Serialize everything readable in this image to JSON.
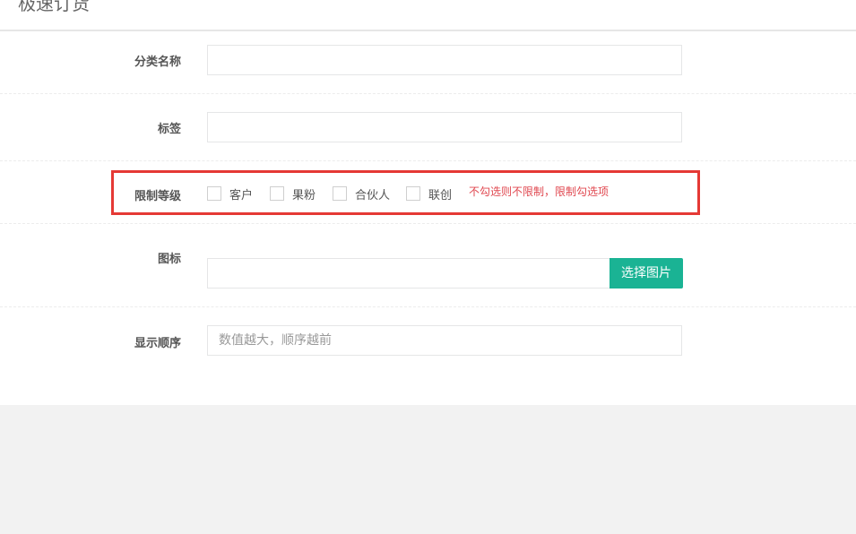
{
  "header": {
    "title": "极速订货"
  },
  "form": {
    "category_name": {
      "label": "分类名称",
      "value": ""
    },
    "tags": {
      "label": "标签",
      "value": ""
    },
    "restrict_level": {
      "label": "限制等级",
      "options": [
        {
          "label": "客户",
          "checked": false
        },
        {
          "label": "果粉",
          "checked": false
        },
        {
          "label": "合伙人",
          "checked": false
        },
        {
          "label": "联创",
          "checked": false
        }
      ],
      "hint": "不勾选则不限制，限制勾选项"
    },
    "icon": {
      "label": "图标",
      "value": "",
      "button_label": "选择图片"
    },
    "display_order": {
      "label": "显示顺序",
      "value": "",
      "placeholder": "数值越大，顺序越前"
    }
  },
  "colors": {
    "accent": "#1ab394",
    "hint": "#e0474f",
    "highlight_border": "#e53935"
  }
}
